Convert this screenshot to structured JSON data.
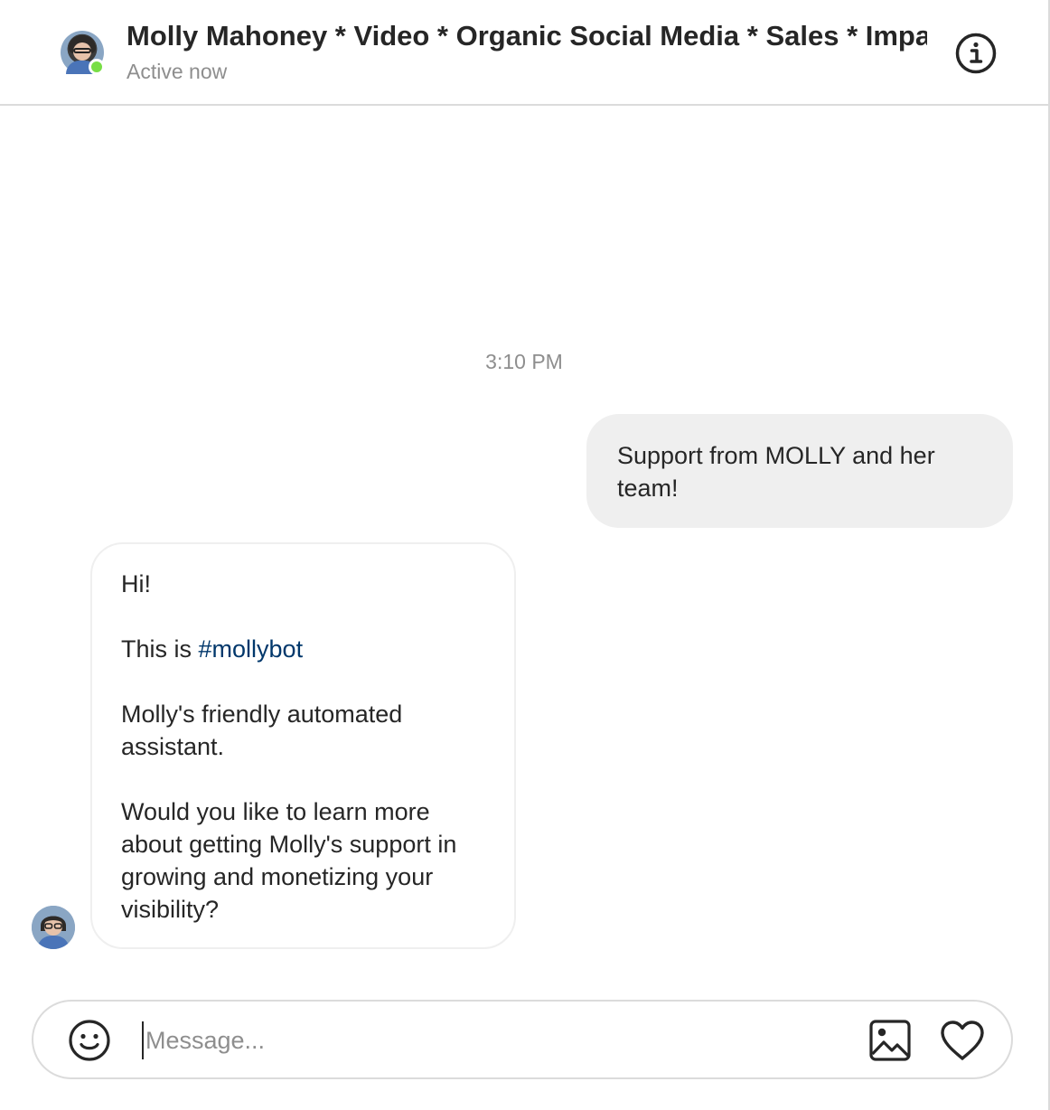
{
  "header": {
    "title": "Molly Mahoney * Video * Organic Social Media * Sales * Impact",
    "status": "Active now",
    "info_icon": "info-icon",
    "avatar_icon": "avatar"
  },
  "conversation": {
    "timestamp": "3:10 PM",
    "outgoing": {
      "text": "Support from MOLLY and her team!"
    },
    "incoming": {
      "line1": "Hi!",
      "line2_prefix": "This is ",
      "line2_hashtag": "#mollybot",
      "line3": "Molly's friendly automated assistant.",
      "line4": "Would you like to learn more about getting Molly's support in growing and monetizing your visibility?"
    }
  },
  "composer": {
    "placeholder": "Message...",
    "value": "",
    "emoji_icon": "emoji-icon",
    "image_icon": "image-icon",
    "like_icon": "heart-icon"
  },
  "colors": {
    "online": "#78de45",
    "bubble_out": "#efefef",
    "hashtag": "#00376b",
    "muted_text": "#8e8e8e",
    "border": "#dbdbdb"
  }
}
